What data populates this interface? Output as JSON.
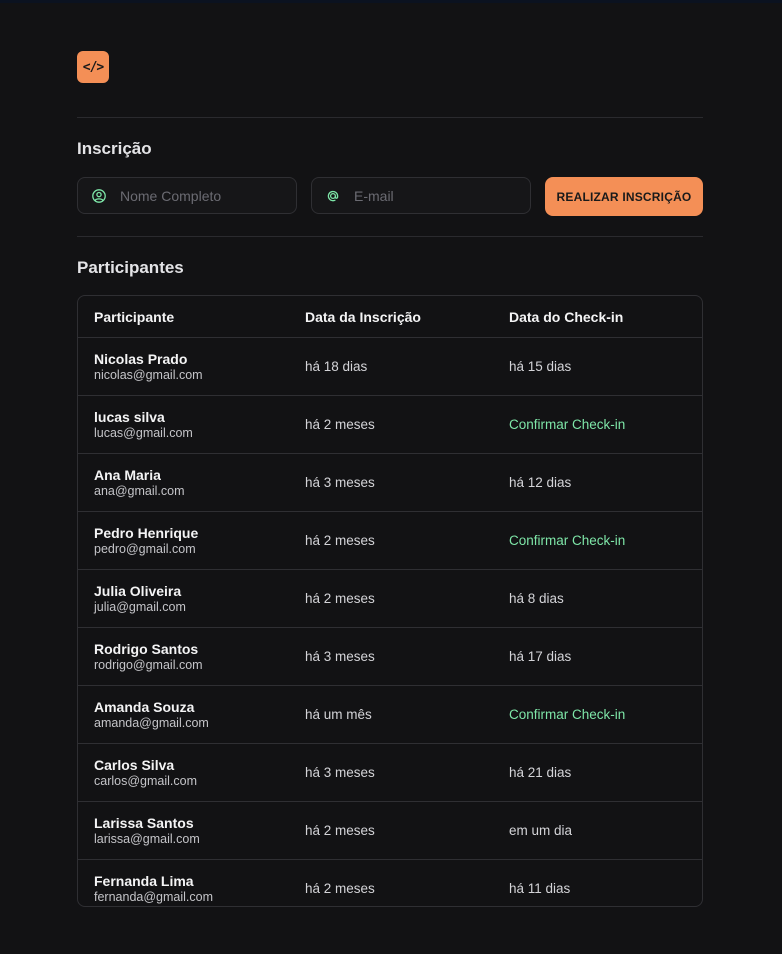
{
  "logo": {
    "glyph": "</>"
  },
  "form": {
    "title": "Inscrição",
    "name_placeholder": "Nome Completo",
    "email_placeholder": "E-mail",
    "submit_label": "REALIZAR INSCRIÇÃO"
  },
  "participants": {
    "title": "Participantes",
    "headers": [
      "Participante",
      "Data da Inscrição",
      "Data do Check-in"
    ],
    "rows": [
      {
        "name": "Nicolas Prado",
        "email": "nicolas@gmail.com",
        "registered": "há 18 dias",
        "checkin": "há 15 dias",
        "checked": true
      },
      {
        "name": "lucas silva",
        "email": "lucas@gmail.com",
        "registered": "há 2 meses",
        "checkin": "Confirmar Check-in",
        "checked": false
      },
      {
        "name": "Ana Maria",
        "email": "ana@gmail.com",
        "registered": "há 3 meses",
        "checkin": "há 12 dias",
        "checked": true
      },
      {
        "name": "Pedro Henrique",
        "email": "pedro@gmail.com",
        "registered": "há 2 meses",
        "checkin": "Confirmar Check-in",
        "checked": false
      },
      {
        "name": "Julia Oliveira",
        "email": "julia@gmail.com",
        "registered": "há 2 meses",
        "checkin": "há 8 dias",
        "checked": true
      },
      {
        "name": "Rodrigo Santos",
        "email": "rodrigo@gmail.com",
        "registered": "há 3 meses",
        "checkin": "há 17 dias",
        "checked": true
      },
      {
        "name": "Amanda Souza",
        "email": "amanda@gmail.com",
        "registered": "há um mês",
        "checkin": "Confirmar Check-in",
        "checked": false
      },
      {
        "name": "Carlos Silva",
        "email": "carlos@gmail.com",
        "registered": "há 3 meses",
        "checkin": "há 21 dias",
        "checked": true
      },
      {
        "name": "Larissa Santos",
        "email": "larissa@gmail.com",
        "registered": "há 2 meses",
        "checkin": "em um dia",
        "checked": true
      },
      {
        "name": "Fernanda Lima",
        "email": "fernanda@gmail.com",
        "registered": "há 2 meses",
        "checkin": "há 11 dias",
        "checked": true
      }
    ]
  },
  "colors": {
    "accent": "#f48f56",
    "confirm": "#7ee6a8",
    "background": "#121214"
  },
  "icons": {
    "name_field": "user-circle-icon",
    "email_field": "at-sign-icon"
  }
}
